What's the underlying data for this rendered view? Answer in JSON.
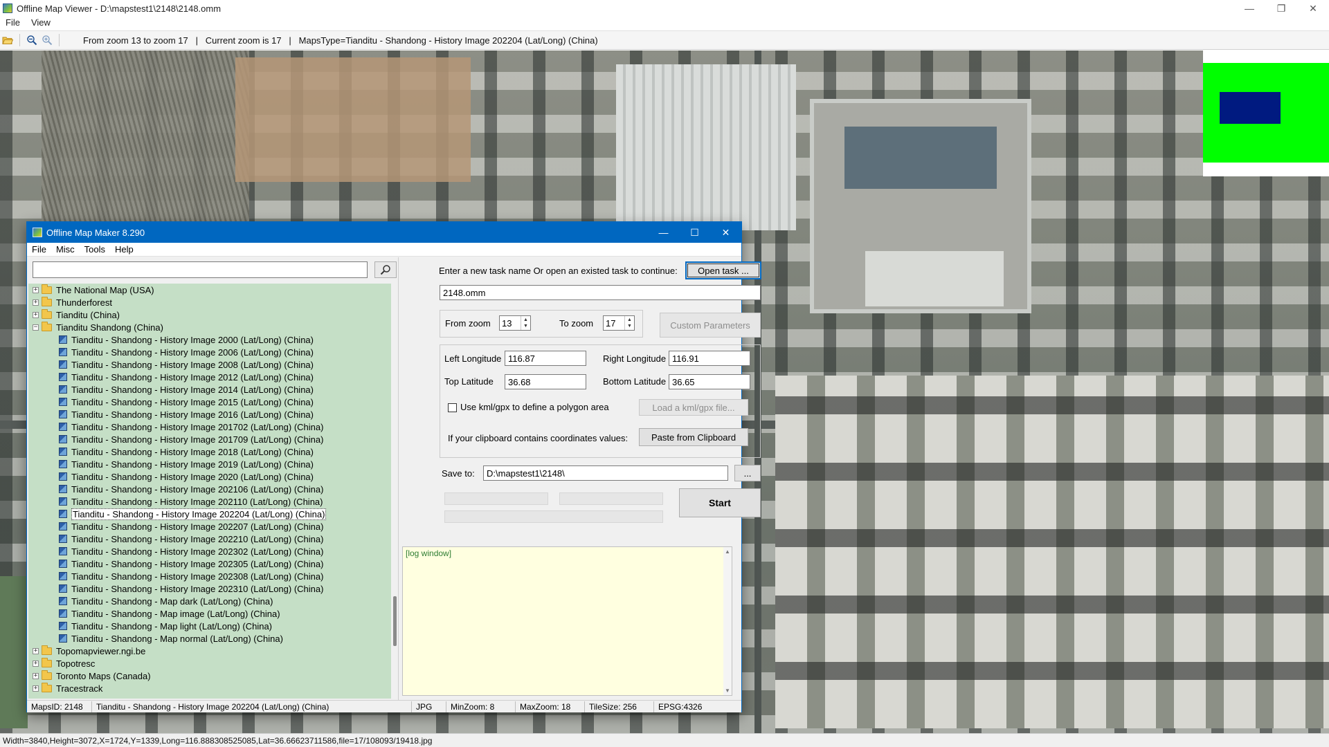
{
  "window": {
    "title": "Offline Map Viewer - D:\\mapstest1\\2148\\2148.omm",
    "controls": {
      "minimize": "—",
      "maximize": "❐",
      "close": "✕"
    }
  },
  "menu": {
    "file": "File",
    "view": "View"
  },
  "toolbar": {
    "info": "From zoom 13 to zoom 17   |   Current zoom is 17   |   MapsType=Tianditu - Shandong - History Image 202204 (Lat/Long) (China)"
  },
  "status": {
    "text": "Width=3840,Height=3072,X=1724,Y=1339,Long=116.888308525085,Lat=36.66623711586,file=17/108093/19418.jpg"
  },
  "dialog": {
    "title": "Offline Map Maker 8.290",
    "controls": {
      "minimize": "—",
      "maximize": "☐",
      "close": "✕"
    },
    "menu": {
      "file": "File",
      "misc": "Misc",
      "tools": "Tools",
      "help": "Help"
    },
    "search": {
      "value": ""
    },
    "tree": [
      {
        "label": "The National Map (USA)",
        "type": "folder",
        "expanded": false,
        "level": 0
      },
      {
        "label": "Thunderforest",
        "type": "folder",
        "expanded": false,
        "level": 0
      },
      {
        "label": "Tianditu (China)",
        "type": "folder",
        "expanded": false,
        "level": 0
      },
      {
        "label": "Tianditu Shandong (China)",
        "type": "folder",
        "expanded": true,
        "level": 0
      },
      {
        "label": "Tianditu - Shandong - History Image 2000 (Lat/Long) (China)",
        "type": "map",
        "level": 1
      },
      {
        "label": "Tianditu - Shandong - History Image 2006 (Lat/Long) (China)",
        "type": "map",
        "level": 1
      },
      {
        "label": "Tianditu - Shandong - History Image 2008 (Lat/Long) (China)",
        "type": "map",
        "level": 1
      },
      {
        "label": "Tianditu - Shandong - History Image 2012 (Lat/Long) (China)",
        "type": "map",
        "level": 1
      },
      {
        "label": "Tianditu - Shandong - History Image 2014 (Lat/Long) (China)",
        "type": "map",
        "level": 1
      },
      {
        "label": "Tianditu - Shandong - History Image 2015 (Lat/Long) (China)",
        "type": "map",
        "level": 1
      },
      {
        "label": "Tianditu - Shandong - History Image 2016 (Lat/Long) (China)",
        "type": "map",
        "level": 1
      },
      {
        "label": "Tianditu - Shandong - History Image 201702 (Lat/Long) (China)",
        "type": "map",
        "level": 1
      },
      {
        "label": "Tianditu - Shandong - History Image 201709 (Lat/Long) (China)",
        "type": "map",
        "level": 1
      },
      {
        "label": "Tianditu - Shandong - History Image 2018 (Lat/Long) (China)",
        "type": "map",
        "level": 1
      },
      {
        "label": "Tianditu - Shandong - History Image 2019 (Lat/Long) (China)",
        "type": "map",
        "level": 1
      },
      {
        "label": "Tianditu - Shandong - History Image 2020 (Lat/Long) (China)",
        "type": "map",
        "level": 1
      },
      {
        "label": "Tianditu - Shandong - History Image 202106 (Lat/Long) (China)",
        "type": "map",
        "level": 1
      },
      {
        "label": "Tianditu - Shandong - History Image 202110 (Lat/Long) (China)",
        "type": "map",
        "level": 1
      },
      {
        "label": "Tianditu - Shandong - History Image 202204 (Lat/Long) (China)",
        "type": "map",
        "level": 1,
        "selected": true
      },
      {
        "label": "Tianditu - Shandong - History Image 202207 (Lat/Long) (China)",
        "type": "map",
        "level": 1
      },
      {
        "label": "Tianditu - Shandong - History Image 202210 (Lat/Long) (China)",
        "type": "map",
        "level": 1
      },
      {
        "label": "Tianditu - Shandong - History Image 202302 (Lat/Long) (China)",
        "type": "map",
        "level": 1
      },
      {
        "label": "Tianditu - Shandong - History Image 202305 (Lat/Long) (China)",
        "type": "map",
        "level": 1
      },
      {
        "label": "Tianditu - Shandong - History Image 202308 (Lat/Long) (China)",
        "type": "map",
        "level": 1
      },
      {
        "label": "Tianditu - Shandong - History Image 202310 (Lat/Long) (China)",
        "type": "map",
        "level": 1
      },
      {
        "label": "Tianditu - Shandong - Map dark (Lat/Long) (China)",
        "type": "map",
        "level": 1
      },
      {
        "label": "Tianditu - Shandong - Map image (Lat/Long) (China)",
        "type": "map",
        "level": 1
      },
      {
        "label": "Tianditu - Shandong - Map light (Lat/Long) (China)",
        "type": "map",
        "level": 1
      },
      {
        "label": "Tianditu - Shandong - Map normal (Lat/Long) (China)",
        "type": "map",
        "level": 1
      },
      {
        "label": "Topomapviewer.ngi.be",
        "type": "folder",
        "expanded": false,
        "level": 0
      },
      {
        "label": "Topotresc",
        "type": "folder",
        "expanded": false,
        "level": 0
      },
      {
        "label": "Toronto Maps (Canada)",
        "type": "folder",
        "expanded": false,
        "level": 0
      },
      {
        "label": "Tracestrack",
        "type": "folder",
        "expanded": false,
        "level": 0
      }
    ],
    "task": {
      "prompt": "Enter a new task name Or open an existed task to continue:",
      "open_button": "Open task ...",
      "name_value": "2148.omm"
    },
    "zoom": {
      "from_label": "From zoom",
      "from_value": "13",
      "to_label": "To zoom",
      "to_value": "17",
      "custom_button": "Custom Parameters"
    },
    "coords": {
      "left_lon_label": "Left Longitude",
      "left_lon_value": "116.87",
      "right_lon_label": "Right Longitude",
      "right_lon_value": "116.91",
      "top_lat_label": "Top Latitude",
      "top_lat_value": "36.68",
      "bottom_lat_label": "Bottom Latitude",
      "bottom_lat_value": "36.65"
    },
    "polygon": {
      "checkbox_label": "Use kml/gpx to define a polygon area",
      "checked": false,
      "load_button": "Load a kml/gpx file..."
    },
    "clipboard": {
      "label": "If your clipboard contains coordinates values:",
      "button": "Paste from Clipboard"
    },
    "save": {
      "label": "Save to:",
      "value": "D:\\mapstest1\\2148\\",
      "browse_button": "..."
    },
    "start_button": "Start",
    "log_title": "[log window]",
    "status": {
      "maps_id": "MapsID: 2148",
      "maps_name": "Tianditu - Shandong - History Image 202204 (Lat/Long) (China)",
      "format": "JPG",
      "min_zoom": "MinZoom: 8",
      "max_zoom": "MaxZoom: 18",
      "tile_size": "TileSize: 256",
      "epsg": "EPSG:4326"
    }
  }
}
